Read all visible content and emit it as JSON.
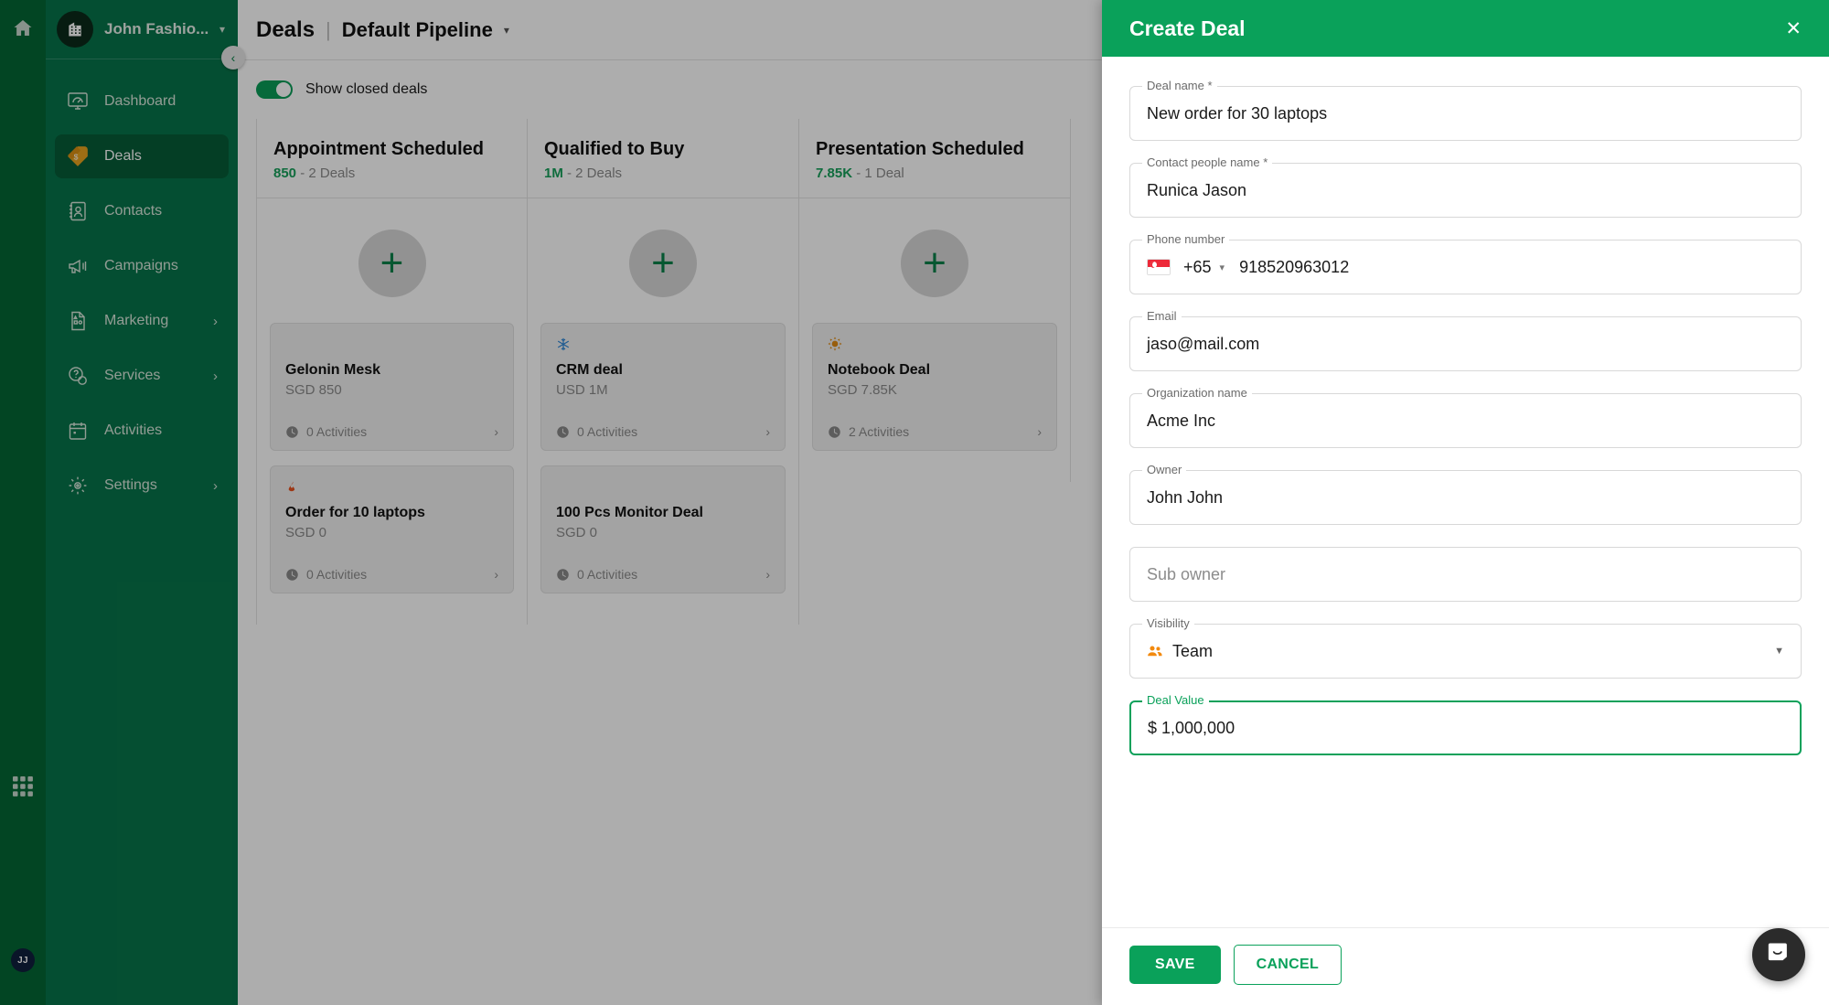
{
  "rail": {
    "home_icon": "home-icon",
    "apps_icon": "apps-grid-icon",
    "avatar_initials": "JJ"
  },
  "sidebar": {
    "org_name": "John Fashio...",
    "org_logo_icon": "building-icon",
    "org_caret_icon": "chevron-down-icon",
    "collapse_icon": "chevron-left-icon",
    "items": [
      {
        "label": "Dashboard",
        "icon": "dashboard-icon",
        "active": false,
        "has_arrow": false
      },
      {
        "label": "Deals",
        "icon": "deal-tag-icon",
        "active": true,
        "has_arrow": false
      },
      {
        "label": "Contacts",
        "icon": "contacts-icon",
        "active": false,
        "has_arrow": false
      },
      {
        "label": "Campaigns",
        "icon": "megaphone-icon",
        "active": false,
        "has_arrow": false
      },
      {
        "label": "Marketing",
        "icon": "marketing-icon",
        "active": false,
        "has_arrow": true
      },
      {
        "label": "Services",
        "icon": "support-icon",
        "active": false,
        "has_arrow": true
      },
      {
        "label": "Activities",
        "icon": "calendar-icon",
        "active": false,
        "has_arrow": false
      },
      {
        "label": "Settings",
        "icon": "gear-icon",
        "active": false,
        "has_arrow": true
      }
    ]
  },
  "header": {
    "breadcrumb_root": "Deals",
    "separator": "|",
    "pipeline": "Default Pipeline",
    "pipeline_caret": "caret-down-icon"
  },
  "toolbar": {
    "show_closed_label": "Show closed deals",
    "show_closed_on": true
  },
  "board": {
    "add_plus": "+",
    "columns": [
      {
        "title": "Appointment Scheduled",
        "amount": "850",
        "count": " - 2 Deals",
        "cards": [
          {
            "flag_icon": "",
            "title": "Gelonin Mesk",
            "amount": "SGD 850",
            "activities": "0 Activities",
            "chevron": "chevron-right-icon"
          },
          {
            "flag_icon": "fire-icon",
            "title": "Order for 10 laptops",
            "amount": "SGD 0",
            "activities": "0 Activities",
            "chevron": "chevron-right-icon"
          }
        ]
      },
      {
        "title": "Qualified to Buy",
        "amount": "1M",
        "count": " - 2 Deals",
        "cards": [
          {
            "flag_icon": "snowflake-icon",
            "title": "CRM deal",
            "amount": "USD 1M",
            "activities": "0 Activities",
            "chevron": "chevron-right-icon"
          },
          {
            "flag_icon": "",
            "title": "100 Pcs Monitor Deal",
            "amount": "SGD 0",
            "activities": "0 Activities",
            "chevron": "chevron-right-icon"
          }
        ]
      },
      {
        "title": "Presentation Scheduled",
        "amount": "7.85K",
        "count": " - 1 Deal",
        "cards": [
          {
            "flag_icon": "sun-icon",
            "title": "Notebook Deal",
            "amount": "SGD 7.85K",
            "activities": "2 Activities",
            "chevron": "chevron-right-icon"
          }
        ]
      }
    ]
  },
  "modal": {
    "title": "Create Deal",
    "close_icon": "close-icon",
    "fields": {
      "deal_name": {
        "label": "Deal name *",
        "value": "New order for 30 laptops"
      },
      "contact_name": {
        "label": "Contact people name *",
        "value": "Runica Jason"
      },
      "phone": {
        "label": "Phone number",
        "flag": "singapore-flag-icon",
        "country_code": "+65",
        "caret": "caret-down-icon",
        "value": "918520963012"
      },
      "email": {
        "label": "Email",
        "value": "jaso@mail.com"
      },
      "organization": {
        "label": "Organization name",
        "value": "Acme Inc"
      },
      "owner": {
        "label": "Owner",
        "value": "John John"
      },
      "sub_owner": {
        "label": "",
        "placeholder": "Sub owner",
        "value": ""
      },
      "visibility": {
        "label": "Visibility",
        "icon": "people-icon",
        "value": "Team",
        "caret": "caret-down-icon"
      },
      "deal_value": {
        "label": "Deal Value",
        "value": "$ 1,000,000",
        "focused": true
      }
    },
    "save_label": "SAVE",
    "cancel_label": "CANCEL"
  },
  "intercom": {
    "icon": "chat-smile-icon"
  },
  "colors": {
    "rail_green": "#046634",
    "sidebar_green": "#07744a",
    "active_green": "#065c37",
    "brand_green": "#0aa15a",
    "amount_green": "#17a05a",
    "avatar_navy": "#0f1f3d",
    "fire_orange": "#e8521f",
    "snow_blue": "#2f86d6",
    "sun_orange": "#e08b14",
    "people_orange": "#f2890d"
  }
}
